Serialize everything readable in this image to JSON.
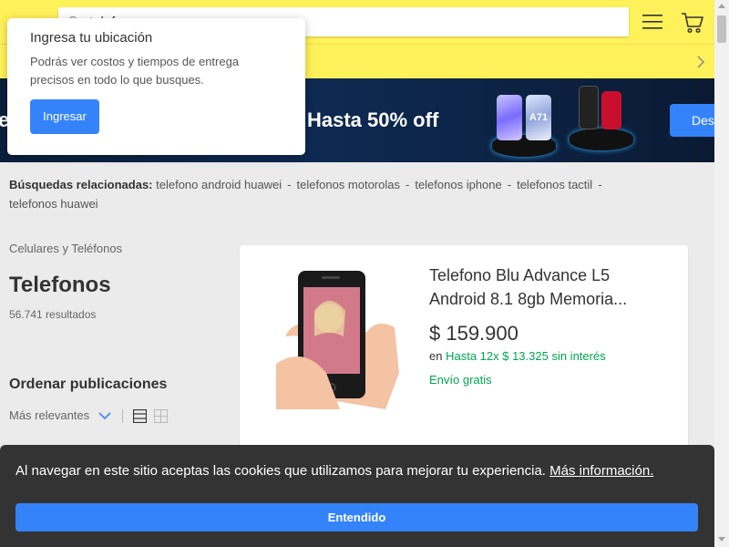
{
  "header": {
    "search_value": "telefonos",
    "colors": {
      "background": "#fff159"
    }
  },
  "banner": {
    "partial_text": "e",
    "offer": "Hasta 50% off",
    "button_partial": "Des",
    "phone_label": "A71"
  },
  "location_popup": {
    "title": "Ingresa tu ubicación",
    "description": "Podrás ver costos y tiempos de entrega precisos en todo lo que busques.",
    "button": "Ingresar"
  },
  "related": {
    "label": "Búsquedas relacionadas:",
    "items": [
      "telefono android huawei",
      "telefonos motorolas",
      "telefonos iphone",
      "telefonos tactil",
      "telefonos huawei"
    ]
  },
  "results": {
    "breadcrumb": "Celulares y Teléfonos",
    "title": "Telefonos",
    "count": "56.741 resultados",
    "sort_title": "Ordenar publicaciones",
    "sort_value": "Más relevantes"
  },
  "product": {
    "title": "Telefono Blu Advance L5 Android 8.1 8gb Memoria...",
    "price": "$ 159.900",
    "installments_prefix": "en",
    "installments": "Hasta 12x $ 13.325 sin interés",
    "shipping": "Envío gratis"
  },
  "cookie": {
    "message": "Al navegar en este sitio aceptas las cookies que utilizamos para mejorar tu experiencia.",
    "link": "Más información.",
    "button": "Entendido"
  },
  "colors": {
    "accent": "#3483fa",
    "green": "#00a650",
    "cookie_bg": "#333333"
  }
}
